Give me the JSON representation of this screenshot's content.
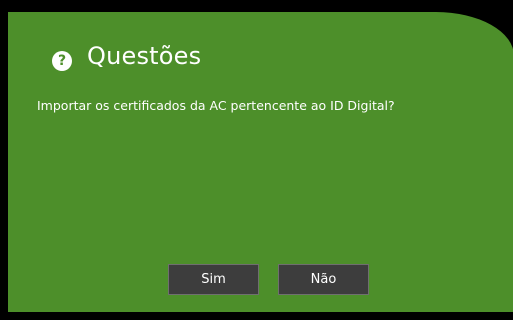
{
  "dialog": {
    "icon": "question-circle-icon",
    "icon_glyph": "?",
    "title": "Questões",
    "message": "Importar os certificados da AC pertencente ao ID Digital?",
    "buttons": {
      "yes_label": "Sim",
      "no_label": "Não"
    }
  },
  "colors": {
    "dialog_bg": "#4d8f2a",
    "button_bg": "#3d3d3d",
    "text": "#ffffff"
  }
}
